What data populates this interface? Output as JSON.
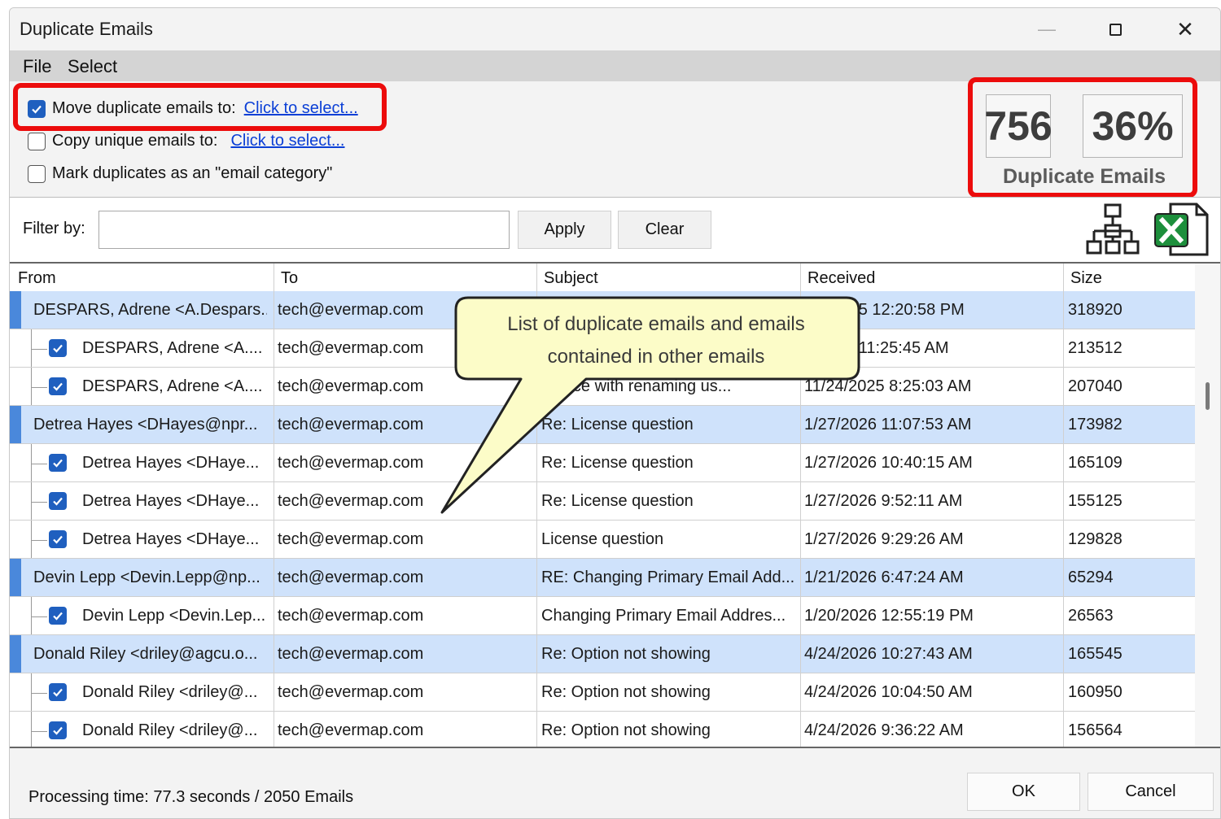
{
  "window": {
    "title": "Duplicate Emails"
  },
  "menu": [
    "File",
    "Select"
  ],
  "options": {
    "move": {
      "label": "Move duplicate emails to:",
      "link": "Click to select...",
      "checked": true
    },
    "copy": {
      "label": "Copy unique emails to:",
      "link": "Click to select...",
      "checked": false
    },
    "mark": {
      "label": "Mark duplicates as an \"email category\"",
      "checked": false
    }
  },
  "stats": {
    "count": "756",
    "percent": "36%",
    "label": "Duplicate Emails"
  },
  "filter": {
    "label": "Filter by:",
    "value": "",
    "apply": "Apply",
    "clear": "Clear"
  },
  "icons": {
    "tree": "hierarchy-icon",
    "excel": "excel-icon"
  },
  "columns": [
    "From",
    "To",
    "Subject",
    "Received",
    "Size"
  ],
  "rows": [
    {
      "group": true,
      "from": "DESPARS, Adrene <A.Despars...",
      "to": "tech@evermap.com",
      "subject": "",
      "received": "1/...2025 12:20:58 PM",
      "size": "318920"
    },
    {
      "group": false,
      "checked": true,
      "from": "DESPARS, Adrene <A....",
      "to": "tech@evermap.com",
      "subject": "",
      "received": "...2025 11:25:45 AM",
      "size": "213512"
    },
    {
      "group": false,
      "checked": true,
      "from": "DESPARS, Adrene <A....",
      "to": "tech@evermap.com",
      "subject": "...ance with renaming us...",
      "received": "11/24/2025 8:25:03 AM",
      "size": "207040"
    },
    {
      "group": true,
      "from": "Detrea Hayes <DHayes@npr...",
      "to": "tech@evermap.com",
      "subject": "Re: License question",
      "received": "1/27/2026 11:07:53 AM",
      "size": "173982"
    },
    {
      "group": false,
      "checked": true,
      "from": "Detrea Hayes <DHaye...",
      "to": "tech@evermap.com",
      "subject": "Re: License question",
      "received": "1/27/2026 10:40:15 AM",
      "size": "165109"
    },
    {
      "group": false,
      "checked": true,
      "from": "Detrea Hayes <DHaye...",
      "to": "tech@evermap.com",
      "subject": "Re: License question",
      "received": "1/27/2026 9:52:11 AM",
      "size": "155125"
    },
    {
      "group": false,
      "checked": true,
      "from": "Detrea Hayes <DHaye...",
      "to": "tech@evermap.com",
      "subject": "License question",
      "received": "1/27/2026 9:29:26 AM",
      "size": "129828"
    },
    {
      "group": true,
      "from": "Devin Lepp <Devin.Lepp@np...",
      "to": "tech@evermap.com",
      "subject": "RE: Changing Primary Email Add...",
      "received": "1/21/2026 6:47:24 AM",
      "size": "65294"
    },
    {
      "group": false,
      "checked": true,
      "from": "Devin Lepp <Devin.Lep...",
      "to": "tech@evermap.com",
      "subject": "Changing Primary Email Addres...",
      "received": "1/20/2026 12:55:19 PM",
      "size": "26563"
    },
    {
      "group": true,
      "from": "Donald Riley <driley@agcu.o...",
      "to": "tech@evermap.com",
      "subject": "Re: Option not showing",
      "received": "4/24/2026 10:27:43 AM",
      "size": "165545"
    },
    {
      "group": false,
      "checked": true,
      "from": "Donald Riley <driley@...",
      "to": "tech@evermap.com",
      "subject": "Re: Option not showing",
      "received": "4/24/2026 10:04:50 AM",
      "size": "160950"
    },
    {
      "group": false,
      "checked": true,
      "from": "Donald Riley <driley@...",
      "to": "tech@evermap.com",
      "subject": "Re: Option not showing",
      "received": "4/24/2026 9:36:22 AM",
      "size": "156564"
    }
  ],
  "callout": {
    "line1": "List of duplicate emails and emails",
    "line2": "contained in other emails"
  },
  "status": "Processing time: 77.3 seconds / 2050 Emails",
  "buttons": {
    "ok": "OK",
    "cancel": "Cancel"
  },
  "colors": {
    "highlight": "#ec0c0c",
    "group_row": "#cfe2fb",
    "group_marker": "#4a88db",
    "checkbox": "#1f5fbf",
    "link": "#0b3fd6",
    "callout_fill": "#fcfcc8"
  }
}
